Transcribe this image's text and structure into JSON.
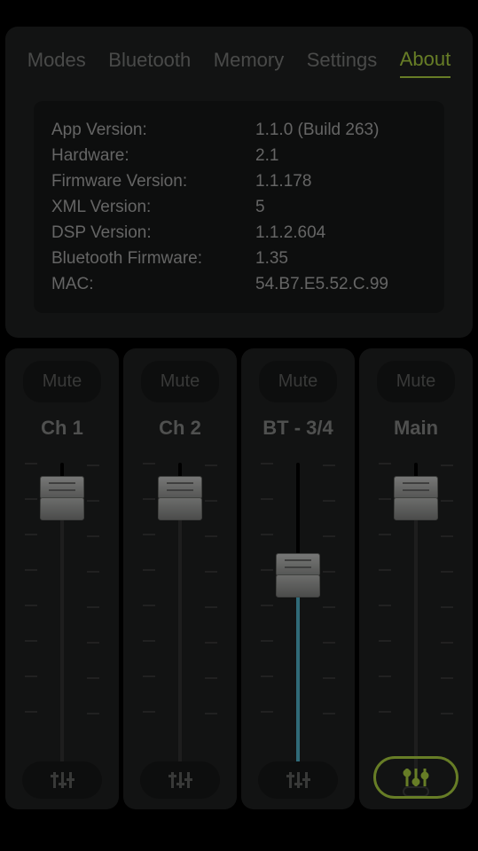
{
  "tabs": {
    "modes": "Modes",
    "bluetooth": "Bluetooth",
    "memory": "Memory",
    "settings": "Settings",
    "about": "About"
  },
  "active_tab": "about",
  "about": {
    "rows": [
      {
        "label": "App Version:",
        "value": "1.1.0 (Build 263)"
      },
      {
        "label": "Hardware:",
        "value": "2.1"
      },
      {
        "label": "Firmware Version:",
        "value": "1.1.178"
      },
      {
        "label": "XML Version:",
        "value": "5"
      },
      {
        "label": "DSP Version:",
        "value": "1.1.2.604"
      },
      {
        "label": "Bluetooth Firmware:",
        "value": "1.35"
      },
      {
        "label": "MAC:",
        "value": "54.B7.E5.52.C.99"
      }
    ]
  },
  "mute_label": "Mute",
  "channels": [
    {
      "key": "ch1",
      "label": "Ch 1",
      "fader": 0.86,
      "active": false
    },
    {
      "key": "ch2",
      "label": "Ch 2",
      "fader": 0.86,
      "active": false
    },
    {
      "key": "bt34",
      "label": "BT - 3/4",
      "fader": 0.55,
      "active": true
    },
    {
      "key": "main",
      "label": "Main",
      "fader": 0.86,
      "active": false,
      "main": true
    }
  ],
  "accent": "#9ec13b",
  "fader_active_color": "#4aa4b9"
}
